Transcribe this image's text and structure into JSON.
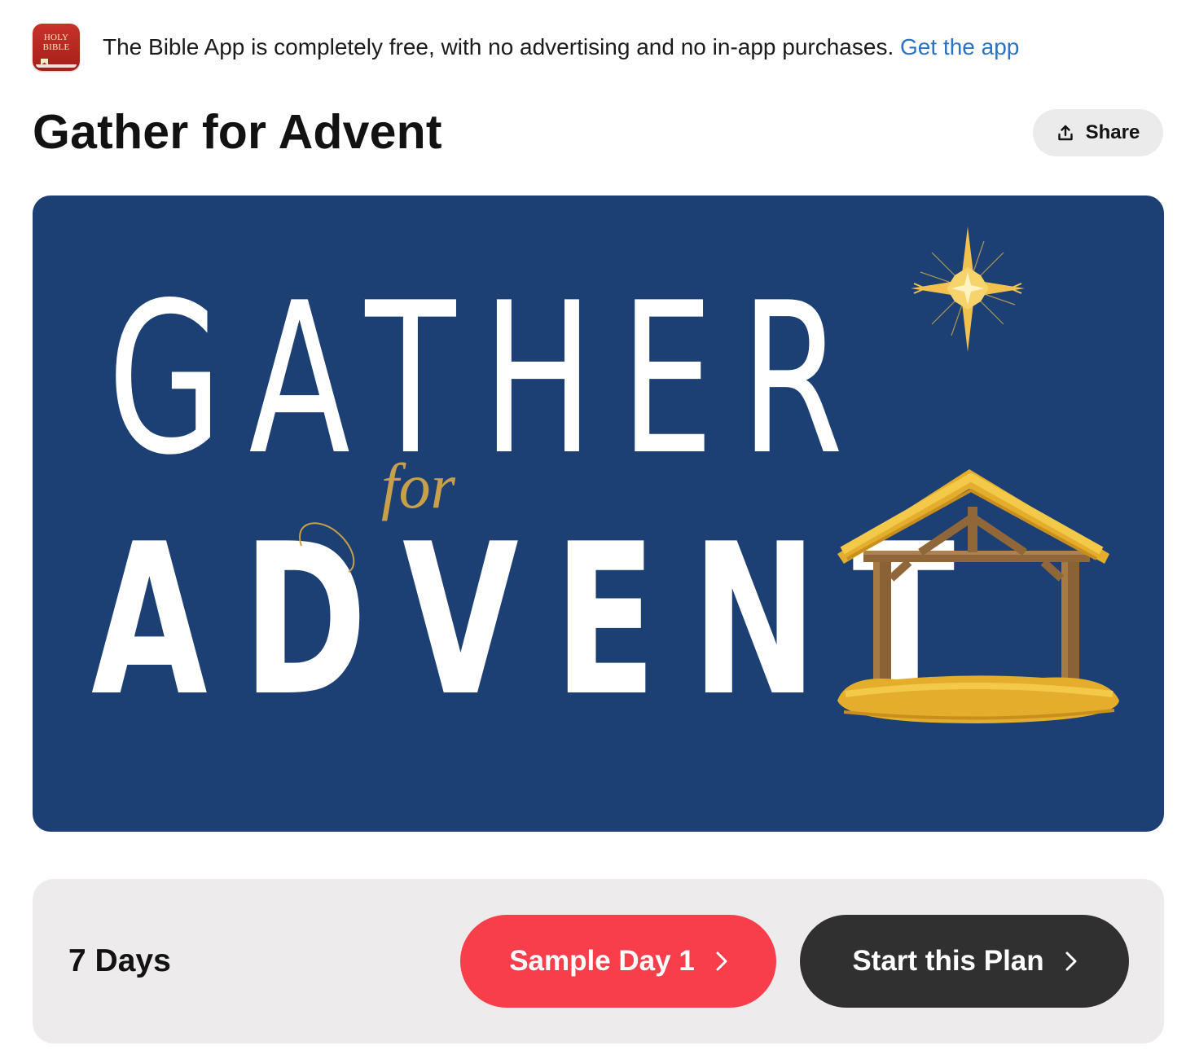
{
  "banner": {
    "icon_line1": "HOLY",
    "icon_line2": "BIBLE",
    "message": "The Bible App is completely free, with no advertising and no in-app purchases.",
    "link_label": "Get the app"
  },
  "plan": {
    "title": "Gather for Advent",
    "share_label": "Share",
    "share_icon": "share-upload-icon",
    "hero": {
      "word_top": "GATHER",
      "word_script": "for",
      "word_bottom": "ADVENT",
      "background_color": "#1c3f74",
      "graphics": [
        "star-icon",
        "manger-stable-icon"
      ]
    },
    "duration_label": "7 Days",
    "sample_button_label": "Sample Day 1",
    "start_button_label": "Start this Plan",
    "chevron_icon": "chevron-right-icon"
  },
  "colors": {
    "link": "#2a73c4",
    "sample_button": "#f93e4b",
    "start_button": "#303030",
    "card_background": "#edebeb"
  }
}
